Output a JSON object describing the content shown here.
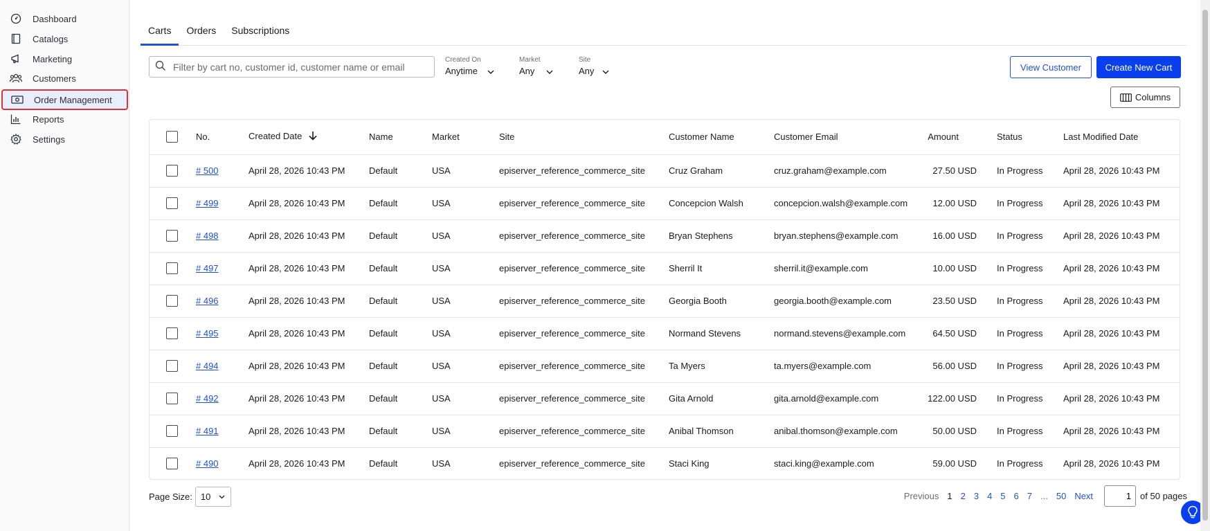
{
  "sidebar": {
    "items": [
      {
        "label": "Dashboard",
        "icon": "dashboard-icon"
      },
      {
        "label": "Catalogs",
        "icon": "book-icon"
      },
      {
        "label": "Marketing",
        "icon": "megaphone-icon"
      },
      {
        "label": "Customers",
        "icon": "users-icon"
      },
      {
        "label": "Order Management",
        "icon": "money-icon",
        "active": true
      },
      {
        "label": "Reports",
        "icon": "bar-chart-icon"
      },
      {
        "label": "Settings",
        "icon": "gear-icon"
      }
    ]
  },
  "tabs": [
    "Carts",
    "Orders",
    "Subscriptions"
  ],
  "search": {
    "placeholder": "Filter by cart no, customer id, customer name or email",
    "value": ""
  },
  "filters": {
    "created_on": {
      "label": "Created On",
      "value": "Anytime"
    },
    "market": {
      "label": "Market",
      "value": "Any"
    },
    "site": {
      "label": "Site",
      "value": "Any"
    }
  },
  "buttons": {
    "view_customer": "View Customer",
    "create_cart": "Create New Cart",
    "columns": "Columns"
  },
  "table": {
    "headers": {
      "no": "No.",
      "created": "Created Date",
      "name": "Name",
      "market": "Market",
      "site": "Site",
      "customer_name": "Customer Name",
      "customer_email": "Customer Email",
      "amount": "Amount",
      "status": "Status",
      "modified": "Last Modified Date"
    },
    "rows": [
      {
        "no": "# 500",
        "created": "April 28, 2026 10:43 PM",
        "name": "Default",
        "market": "USA",
        "site": "episerver_reference_commerce_site",
        "customer_name": "Cruz Graham",
        "customer_email": "cruz.graham@example.com",
        "amount": "27.50 USD",
        "status": "In Progress",
        "modified": "April 28, 2026 10:43 PM"
      },
      {
        "no": "# 499",
        "created": "April 28, 2026 10:43 PM",
        "name": "Default",
        "market": "USA",
        "site": "episerver_reference_commerce_site",
        "customer_name": "Concepcion Walsh",
        "customer_email": "concepcion.walsh@example.com",
        "amount": "12.00 USD",
        "status": "In Progress",
        "modified": "April 28, 2026 10:43 PM"
      },
      {
        "no": "# 498",
        "created": "April 28, 2026 10:43 PM",
        "name": "Default",
        "market": "USA",
        "site": "episerver_reference_commerce_site",
        "customer_name": "Bryan Stephens",
        "customer_email": "bryan.stephens@example.com",
        "amount": "16.00 USD",
        "status": "In Progress",
        "modified": "April 28, 2026 10:43 PM"
      },
      {
        "no": "# 497",
        "created": "April 28, 2026 10:43 PM",
        "name": "Default",
        "market": "USA",
        "site": "episerver_reference_commerce_site",
        "customer_name": "Sherril It",
        "customer_email": "sherril.it@example.com",
        "amount": "10.00 USD",
        "status": "In Progress",
        "modified": "April 28, 2026 10:43 PM"
      },
      {
        "no": "# 496",
        "created": "April 28, 2026 10:43 PM",
        "name": "Default",
        "market": "USA",
        "site": "episerver_reference_commerce_site",
        "customer_name": "Georgia Booth",
        "customer_email": "georgia.booth@example.com",
        "amount": "23.50 USD",
        "status": "In Progress",
        "modified": "April 28, 2026 10:43 PM"
      },
      {
        "no": "# 495",
        "created": "April 28, 2026 10:43 PM",
        "name": "Default",
        "market": "USA",
        "site": "episerver_reference_commerce_site",
        "customer_name": "Normand Stevens",
        "customer_email": "normand.stevens@example.com",
        "amount": "64.50 USD",
        "status": "In Progress",
        "modified": "April 28, 2026 10:43 PM"
      },
      {
        "no": "# 494",
        "created": "April 28, 2026 10:43 PM",
        "name": "Default",
        "market": "USA",
        "site": "episerver_reference_commerce_site",
        "customer_name": "Ta Myers",
        "customer_email": "ta.myers@example.com",
        "amount": "56.00 USD",
        "status": "In Progress",
        "modified": "April 28, 2026 10:43 PM"
      },
      {
        "no": "# 492",
        "created": "April 28, 2026 10:43 PM",
        "name": "Default",
        "market": "USA",
        "site": "episerver_reference_commerce_site",
        "customer_name": "Gita Arnold",
        "customer_email": "gita.arnold@example.com",
        "amount": "122.00 USD",
        "status": "In Progress",
        "modified": "April 28, 2026 10:43 PM"
      },
      {
        "no": "# 491",
        "created": "April 28, 2026 10:43 PM",
        "name": "Default",
        "market": "USA",
        "site": "episerver_reference_commerce_site",
        "customer_name": "Anibal Thomson",
        "customer_email": "anibal.thomson@example.com",
        "amount": "50.00 USD",
        "status": "In Progress",
        "modified": "April 28, 2026 10:43 PM"
      },
      {
        "no": "# 490",
        "created": "April 28, 2026 10:43 PM",
        "name": "Default",
        "market": "USA",
        "site": "episerver_reference_commerce_site",
        "customer_name": "Staci King",
        "customer_email": "staci.king@example.com",
        "amount": "59.00 USD",
        "status": "In Progress",
        "modified": "April 28, 2026 10:43 PM"
      }
    ]
  },
  "pagination": {
    "page_size_label": "Page Size:",
    "page_size": "10",
    "previous": "Previous",
    "next": "Next",
    "pages": [
      "1",
      "2",
      "3",
      "4",
      "5",
      "6",
      "7",
      "...",
      "50"
    ],
    "current": "1",
    "of_label": "of 50 pages"
  },
  "colors": {
    "accent": "#0a3ff0",
    "link": "#1f52d6",
    "highlight": "#e0313b"
  }
}
